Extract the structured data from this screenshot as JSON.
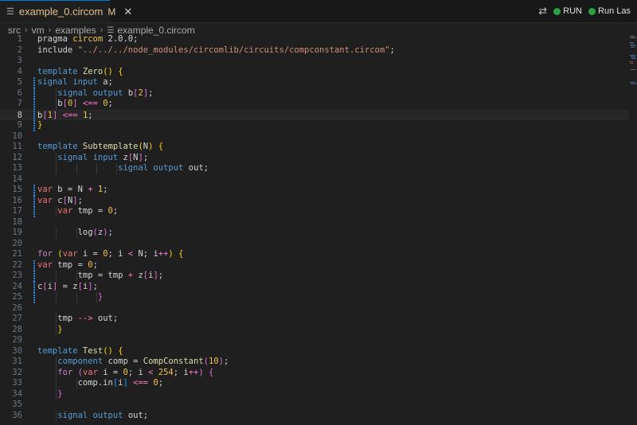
{
  "tab": {
    "file_name": "example_0.circom",
    "modified": "M",
    "close": "✕"
  },
  "actions": {
    "run_label": "RUN",
    "run_last_label": "Run Las"
  },
  "breadcrumb": [
    "src",
    "vm",
    "examples",
    "example_0.circom"
  ],
  "active_line": 8,
  "lines": [
    {
      "n": "1",
      "html": "<span class='o'>pragma </span><span class='num'>circom</span><span class='o'> 2.0.0;</span>"
    },
    {
      "n": "2",
      "html": "<span class='o'>include </span><span class='s'>\"../../../node_modules/circomlib/circuits/compconstant.circom\"</span><span class='o'>;</span>"
    },
    {
      "n": "3",
      "html": ""
    },
    {
      "n": "4",
      "html": "<span class='k'>template</span><span class='o'> </span><span class='m'>Zero</span><span class='p1'>()</span><span class='o'> </span><span class='p1'>{</span>"
    },
    {
      "n": "5",
      "html": "<span class='k'>signal</span><span class='o'> </span><span class='k'>input</span><span class='o'> a;</span>"
    },
    {
      "n": "6",
      "html": "<span class='o'>    </span><span class='k'>signal</span><span class='o'> </span><span class='k'>output</span><span class='o'> b</span><span class='p2'>[</span><span class='num'>2</span><span class='p2'>]</span><span class='o'>;</span>"
    },
    {
      "n": "7",
      "html": "<span class='o'>    b</span><span class='p2'>[</span><span class='num'>0</span><span class='p2'>]</span><span class='o'> </span><span class='pink'>&lt;==</span><span class='o'> </span><span class='num'>0</span><span class='o'>;</span>"
    },
    {
      "n": "8",
      "html": "<span class='o'>b</span><span class='p2'>[</span><span class='num'>1</span><span class='p2'>]</span><span class='o'> </span><span class='pink'>&lt;==</span><span class='o'> </span><span class='num'>1</span><span class='o'>;</span>"
    },
    {
      "n": "9",
      "html": "<span class='p1'>}</span>"
    },
    {
      "n": "10",
      "html": ""
    },
    {
      "n": "11",
      "html": "<span class='k'>template</span><span class='o'> </span><span class='m'>Subtemplate</span><span class='p1'>(</span><span class='o'>N</span><span class='p1'>)</span><span class='o'> </span><span class='p1'>{</span>"
    },
    {
      "n": "12",
      "html": "<span class='o'>    </span><span class='k'>signal</span><span class='o'> </span><span class='k'>input</span><span class='o'> z</span><span class='p2'>[</span><span class='o'>N</span><span class='p2'>]</span><span class='o'>;</span>"
    },
    {
      "n": "13",
      "html": "<span class='o'>                </span><span class='k'>signal</span><span class='o'> </span><span class='k'>output</span><span class='o'> out;</span>"
    },
    {
      "n": "14",
      "html": ""
    },
    {
      "n": "15",
      "html": "<span class='kw2'>var</span><span class='o'> b = N </span><span class='pink'>+</span><span class='o'> </span><span class='num'>1</span><span class='o'>;</span>"
    },
    {
      "n": "16",
      "html": "<span class='kw2'>var</span><span class='o'> c</span><span class='p2'>[</span><span class='o'>N</span><span class='p2'>]</span><span class='o'>;</span>"
    },
    {
      "n": "17",
      "html": "<span class='o'>    </span><span class='kw2'>var</span><span class='o'> tmp = </span><span class='num'>0</span><span class='o'>;</span>"
    },
    {
      "n": "18",
      "html": ""
    },
    {
      "n": "19",
      "html": "<span class='o'>        log</span><span class='p2'>(</span><span class='o'>z</span><span class='p2'>)</span><span class='o'>;</span>"
    },
    {
      "n": "20",
      "html": ""
    },
    {
      "n": "21",
      "html": "<span class='c'>for</span><span class='o'> </span><span class='p1'>(</span><span class='kw2'>var</span><span class='o'> i = </span><span class='num'>0</span><span class='o'>; i </span><span class='pink'>&lt;</span><span class='o'> N; i</span><span class='pink'>++</span><span class='p1'>)</span><span class='o'> </span><span class='p1'>{</span>"
    },
    {
      "n": "22",
      "html": "<span class='kw2'>var</span><span class='o'> tmp = </span><span class='num'>0</span><span class='o'>;</span>"
    },
    {
      "n": "23",
      "html": "<span class='o'>        tmp = tmp </span><span class='pink'>+</span><span class='o'> z</span><span class='p2'>[</span><span class='o'>i</span><span class='p2'>]</span><span class='o'>;</span>"
    },
    {
      "n": "24",
      "html": "<span class='o'>c</span><span class='p2'>[</span><span class='o'>i</span><span class='p2'>]</span><span class='o'> = z</span><span class='p2'>[</span><span class='o'>i</span><span class='p2'>]</span><span class='o'>;</span>"
    },
    {
      "n": "25",
      "html": "<span class='o'>            </span><span class='p2'>}</span>"
    },
    {
      "n": "26",
      "html": ""
    },
    {
      "n": "27",
      "html": "<span class='o'>    tmp </span><span class='pink'>--&gt;</span><span class='o'> out;</span>"
    },
    {
      "n": "28",
      "html": "<span class='o'>    </span><span class='p1'>}</span>"
    },
    {
      "n": "29",
      "html": ""
    },
    {
      "n": "30",
      "html": "<span class='k'>template</span><span class='o'> </span><span class='m'>Test</span><span class='p1'>()</span><span class='o'> </span><span class='p1'>{</span>"
    },
    {
      "n": "31",
      "html": "<span class='o'>    </span><span class='k'>component</span><span class='o'> comp = </span><span class='m'>CompConstant</span><span class='p2'>(</span><span class='num'>10</span><span class='p2'>)</span><span class='o'>;</span>"
    },
    {
      "n": "32",
      "html": "<span class='o'>    </span><span class='c'>for</span><span class='o'> </span><span class='p2'>(</span><span class='kw2'>var</span><span class='o'> i = </span><span class='num'>0</span><span class='o'>; i </span><span class='pink'>&lt;</span><span class='o'> </span><span class='num'>254</span><span class='o'>; i</span><span class='pink'>++</span><span class='p2'>)</span><span class='o'> </span><span class='p2'>{</span>"
    },
    {
      "n": "33",
      "html": "<span class='o'>        comp.in</span><span class='p3'>[</span><span class='o'>i</span><span class='p3'>]</span><span class='o'> </span><span class='pink'>&lt;==</span><span class='o'> </span><span class='num'>0</span><span class='o'>;</span>"
    },
    {
      "n": "34",
      "html": "<span class='o'>    </span><span class='p2'>}</span>"
    },
    {
      "n": "35",
      "html": ""
    },
    {
      "n": "36",
      "html": "<span class='o'>    </span><span class='k'>signal</span><span class='o'> </span><span class='k'>output</span><span class='o'> out;</span>"
    }
  ],
  "changed_lines": [
    "5",
    "6",
    "7",
    "8",
    "9",
    "15",
    "16",
    "17",
    "22",
    "23",
    "24",
    "25"
  ],
  "colors": {
    "accent": "#0078d4",
    "run": "#2ea043",
    "modified": "#e2c08d"
  }
}
